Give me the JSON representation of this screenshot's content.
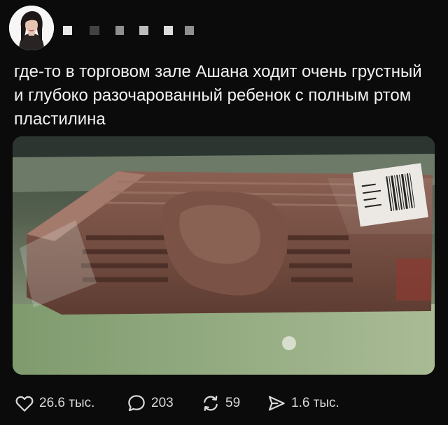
{
  "post": {
    "text": "где-то в торговом зале Ашана ходит очень грустный и глубоко разочарованный ребенок с полным ртом пластилина",
    "media_icon": "photo-of-bitten-plasticine-pack"
  },
  "author": {
    "avatar_icon": "user-avatar-photo",
    "name_icon": "redacted-username-blocks"
  },
  "actions": {
    "likes": "26.6 тыс.",
    "comments": "203",
    "reposts": "59",
    "views": "1.6 тыс."
  },
  "icons": {
    "like": "heart-icon",
    "comment": "speech-bubble-icon",
    "repost": "repost-arrows-icon",
    "share": "send-arrow-icon"
  },
  "colors": {
    "background": "#0b0b0b",
    "text": "#f3f3f3",
    "icon": "#d8d8d8"
  }
}
